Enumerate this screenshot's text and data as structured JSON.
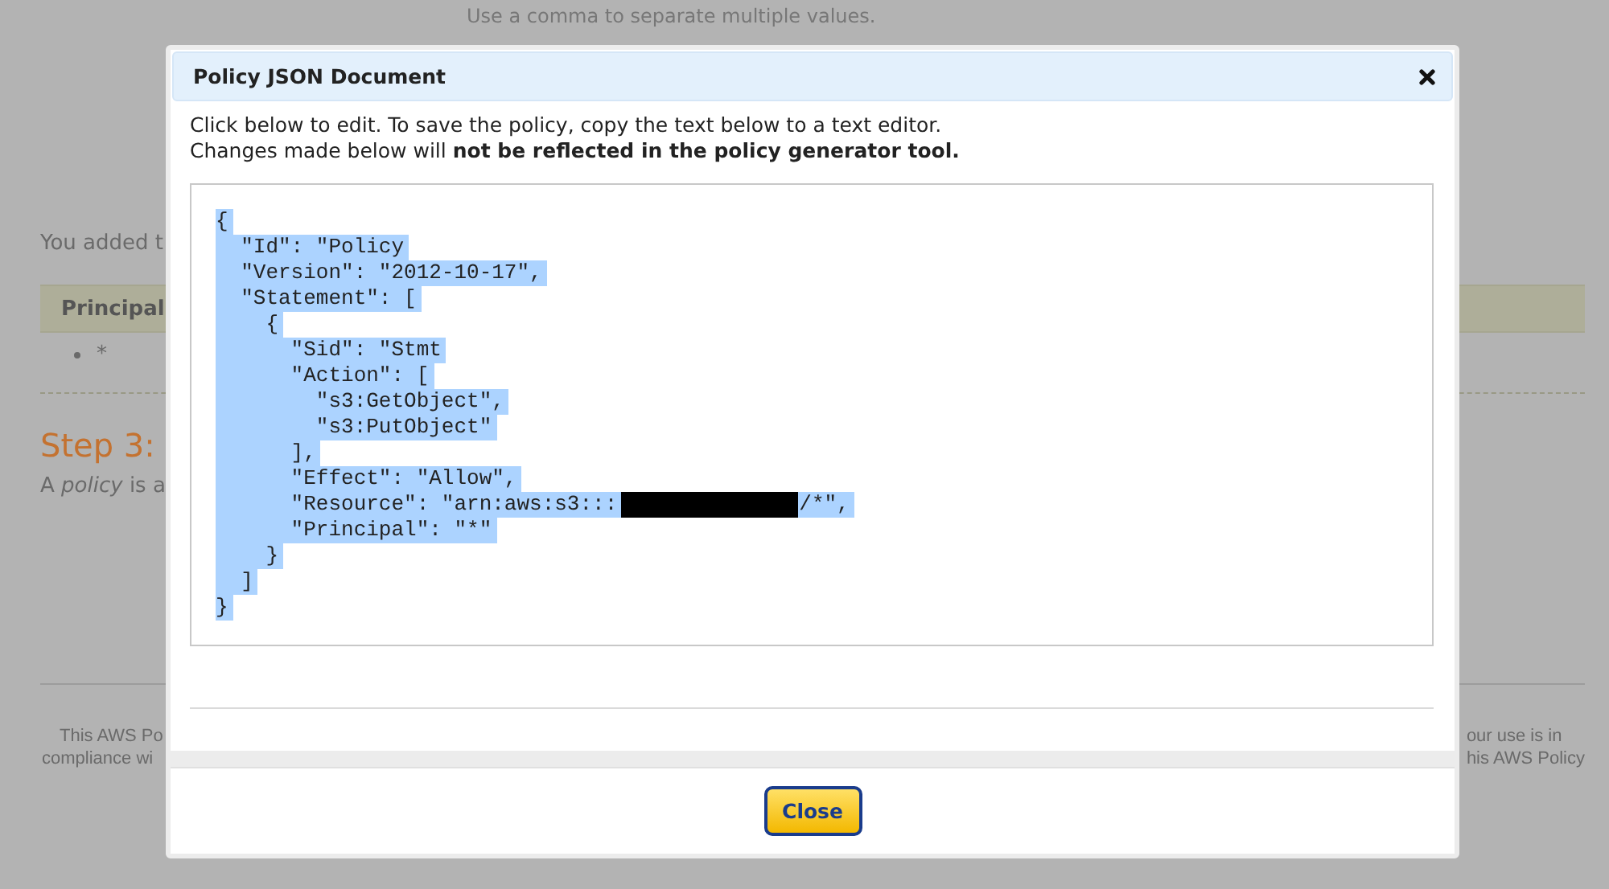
{
  "page": {
    "hint": "Use a comma to separate multiple values.",
    "added_text": "You added t",
    "principal_header": "Principal",
    "principal_items": [
      "*"
    ],
    "step_title": "Step 3:",
    "step_text": "A *policy* is a",
    "footer_left": [
      "This AWS Po",
      "compliance wi"
    ],
    "footer_right": [
      "our use is in",
      "his AWS Policy"
    ]
  },
  "dialog": {
    "title": "Policy JSON Document",
    "intro": [
      "Click below to edit. To save the policy, copy the text below to a text editor.",
      "Changes made below will **not be reflected in the policy generator tool.**"
    ],
    "code": {
      "selected": true,
      "lines": [
        {
          "text": "{"
        },
        {
          "text": "  \"Id\": \"Policy"
        },
        {
          "text": "  \"Version\": \"2012-10-17\","
        },
        {
          "text": "  \"Statement\": ["
        },
        {
          "text": "    {"
        },
        {
          "text": "      \"Sid\": \"Stmt"
        },
        {
          "text": "      \"Action\": ["
        },
        {
          "text": "        \"s3:GetObject\","
        },
        {
          "text": "        \"s3:PutObject\""
        },
        {
          "text": "      ],"
        },
        {
          "text": "      \"Effect\": \"Allow\","
        },
        {
          "text": "      \"Resource\": \"arn:aws:s3:::",
          "redacted": true,
          "after": "/*\","
        },
        {
          "text": "      \"Principal\": \"*\""
        },
        {
          "text": "    }"
        },
        {
          "text": "  ]"
        },
        {
          "text": "}"
        }
      ]
    },
    "button": "Close"
  }
}
